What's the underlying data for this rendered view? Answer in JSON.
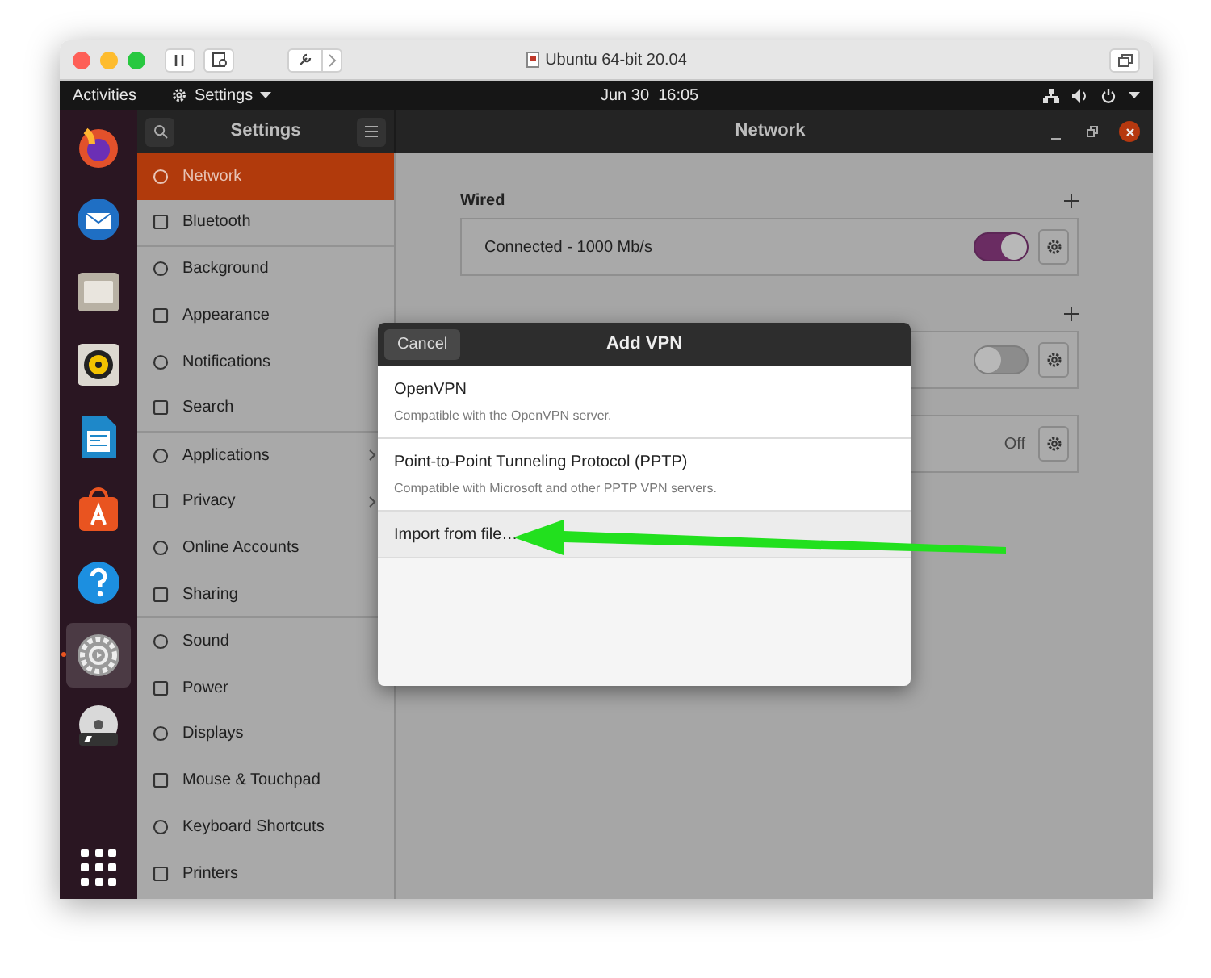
{
  "vm_window": {
    "title": "Ubuntu 64-bit 20.04"
  },
  "top_bar": {
    "activities": "Activities",
    "app_menu": "Settings",
    "clock": "Jun 30  16:05"
  },
  "dock": {
    "items": [
      {
        "selected": false
      },
      {
        "selected": false
      },
      {
        "selected": false
      },
      {
        "selected": false
      },
      {
        "selected": false
      },
      {
        "selected": false
      },
      {
        "selected": false
      },
      {
        "selected": true
      },
      {
        "selected": false
      }
    ]
  },
  "header_bar": {
    "sidebar_title": "Settings",
    "page_title": "Network"
  },
  "sidebar": {
    "items": [
      {
        "label": "Network",
        "selected": true,
        "submenu": false,
        "separator_after": false
      },
      {
        "label": "Bluetooth",
        "selected": false,
        "submenu": false,
        "separator_after": true
      },
      {
        "label": "Background",
        "selected": false,
        "submenu": false,
        "separator_after": false
      },
      {
        "label": "Appearance",
        "selected": false,
        "submenu": false,
        "separator_after": false
      },
      {
        "label": "Notifications",
        "selected": false,
        "submenu": false,
        "separator_after": false
      },
      {
        "label": "Search",
        "selected": false,
        "submenu": false,
        "separator_after": true
      },
      {
        "label": "Applications",
        "selected": false,
        "submenu": true,
        "separator_after": false
      },
      {
        "label": "Privacy",
        "selected": false,
        "submenu": true,
        "separator_after": false
      },
      {
        "label": "Online Accounts",
        "selected": false,
        "submenu": false,
        "separator_after": false
      },
      {
        "label": "Sharing",
        "selected": false,
        "submenu": false,
        "separator_after": true
      },
      {
        "label": "Sound",
        "selected": false,
        "submenu": false,
        "separator_after": false
      },
      {
        "label": "Power",
        "selected": false,
        "submenu": false,
        "separator_after": false
      },
      {
        "label": "Displays",
        "selected": false,
        "submenu": false,
        "separator_after": false
      },
      {
        "label": "Mouse & Touchpad",
        "selected": false,
        "submenu": false,
        "separator_after": false
      },
      {
        "label": "Keyboard Shortcuts",
        "selected": false,
        "submenu": false,
        "separator_after": false
      },
      {
        "label": "Printers",
        "selected": false,
        "submenu": false,
        "separator_after": false
      }
    ]
  },
  "content": {
    "sections": [
      {
        "title": "Wired",
        "add_button": true,
        "cards": [
          {
            "kind": "switch",
            "label": "Connected - 1000 Mb/s",
            "on": true
          }
        ]
      },
      {
        "add_button": true,
        "cards": [
          {
            "kind": "switch",
            "on": false
          }
        ]
      },
      {
        "add_button": false,
        "cards": [
          {
            "kind": "status",
            "value": "Off"
          }
        ]
      }
    ]
  },
  "dialog": {
    "title": "Add VPN",
    "cancel": "Cancel",
    "options": [
      {
        "title": "OpenVPN",
        "description": "Compatible with the OpenVPN server.",
        "selected": false
      },
      {
        "title": "Point-to-Point Tunneling Protocol (PPTP)",
        "description": "Compatible with Microsoft and other PPTP VPN servers.",
        "selected": false
      },
      {
        "title": "Import from file…",
        "selected": true
      }
    ]
  }
}
